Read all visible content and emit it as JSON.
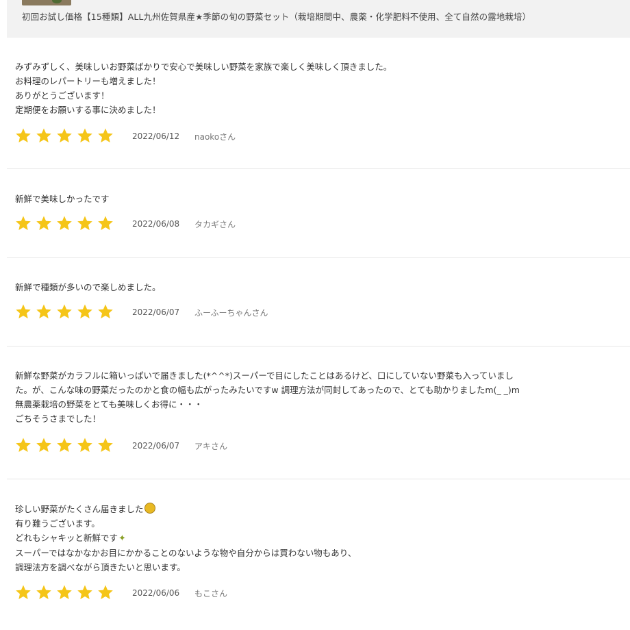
{
  "product": {
    "title": "初回お試し価格【15種類】ALL九州佐賀県産★季節の旬の野菜セット（栽培期間中、農薬・化学肥料不使用、全て自然の露地栽培）"
  },
  "reviews": [
    {
      "lines": [
        "みずみずしく、美味しいお野菜ばかりで安心で美味しい野菜を家族で楽しく美味しく頂きました。",
        "お料理のレパートリーも増えました！",
        "ありがとうございます！",
        "定期便をお願いする事に決めました！"
      ],
      "rating": 5,
      "date": "2022/06/12",
      "author": "naokoさん"
    },
    {
      "lines": [
        "新鮮で美味しかったです"
      ],
      "rating": 5,
      "date": "2022/06/08",
      "author": "タカギさん"
    },
    {
      "lines": [
        "新鮮で種類が多いので楽しめました。"
      ],
      "rating": 5,
      "date": "2022/06/07",
      "author": "ふーふーちゃんさん"
    },
    {
      "lines": [
        "新鮮な野菜がカラフルに箱いっぱいで届きました(*^^*)スーパーで目にしたことはあるけど、口にしていない野菜も入っていまし",
        "た。が、こんな味の野菜だったのかと食の幅も広がったみたいですw 調理方法が同封してあったので、とても助かりましたm(_ _)m",
        "無農薬栽培の野菜をとても美味しくお得に・・・",
        "ごちそうさまでした！"
      ],
      "rating": 5,
      "date": "2022/06/07",
      "author": "アキさん"
    },
    {
      "lines": [
        "珍しい野菜がたくさん届きました",
        "有り難うございます。",
        "どれもシャキッと新鮮です",
        "スーパーではなかなかお目にかかることのないような物や自分からは買わない物もあり、",
        "調理法方を調べながら頂きたいと思います。"
      ],
      "emoji": {
        "line0": "grinning-face-icon",
        "line2": "sparkle-icon"
      },
      "rating": 5,
      "date": "2022/06/06",
      "author": "もこさん"
    }
  ],
  "colors": {
    "star": "#f5c518",
    "header_bg": "#f2f2f2"
  }
}
